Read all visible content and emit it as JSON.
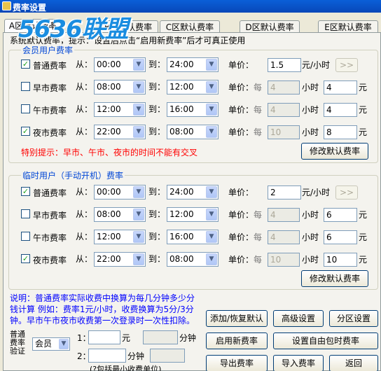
{
  "window": {
    "title": "费率设置"
  },
  "tabs": [
    {
      "label": "A区默认费率"
    },
    {
      "label": "B区默认费率"
    },
    {
      "label": "C区默认费率"
    },
    {
      "label": "D区默认费率"
    },
    {
      "label": "E区默认费率"
    }
  ],
  "hint": "系统默认费率，提示：设置后点击“启用新费率”后才可真正使用",
  "watermark": "5636联盟",
  "common": {
    "from": "从：",
    "to": "到：",
    "price": "单价：",
    "per": "每",
    "hour": "小时",
    "yuan": "元",
    "yuan_per_hour": "元/小时",
    "next_btn": ">>"
  },
  "member": {
    "title": "会员用户费率",
    "rows": [
      {
        "name": "普通费率",
        "checked": true,
        "from": "00:00",
        "to": "24:00",
        "price": "1.5",
        "per_hours": "",
        "amount": ""
      },
      {
        "name": "早市费率",
        "checked": false,
        "from": "08:00",
        "to": "12:00",
        "price": "",
        "per_hours": "4",
        "amount": "4"
      },
      {
        "name": "午市费率",
        "checked": false,
        "from": "12:00",
        "to": "16:00",
        "price": "",
        "per_hours": "4",
        "amount": "4"
      },
      {
        "name": "夜市费率",
        "checked": true,
        "from": "22:00",
        "to": "08:00",
        "price": "",
        "per_hours": "10",
        "amount": "8"
      }
    ],
    "warning": "特别提示：早市、午市、夜市的时间不能有交叉",
    "modify_btn": "修改默认费率"
  },
  "temp": {
    "title": "临时用户（手动开机）费率",
    "rows": [
      {
        "name": "普通费率",
        "checked": true,
        "from": "00:00",
        "to": "24:00",
        "price": "2",
        "per_hours": "",
        "amount": ""
      },
      {
        "name": "早市费率",
        "checked": false,
        "from": "08:00",
        "to": "12:00",
        "price": "",
        "per_hours": "4",
        "amount": "6"
      },
      {
        "name": "午市费率",
        "checked": false,
        "from": "12:00",
        "to": "16:00",
        "price": "",
        "per_hours": "4",
        "amount": "6"
      },
      {
        "name": "夜市费率",
        "checked": true,
        "from": "22:00",
        "to": "08:00",
        "price": "",
        "per_hours": "10",
        "amount": "10"
      }
    ],
    "modify_btn": "修改默认费率"
  },
  "note": "说明：普通费率实际收费中换算为每几分钟多少分钱计算 例如：费率1元/小时，收费换算为5分/3分钟。早市午市夜市收费第一次登录时一次性扣除。",
  "verify": {
    "label": "普通费率验证",
    "select": "会员",
    "row1_prefix": "1：",
    "row1_unit1": "元",
    "row1_unit2": "分钟",
    "row2_prefix": "2：",
    "row2_unit1": "分钟",
    "footer": "(?包括最小收费单位)"
  },
  "buttons": {
    "restore": "添加/恢复默认",
    "advanced": "高级设置",
    "zone": "分区设置",
    "enable": "启用新费率",
    "free_pkg": "设置自由包时费率",
    "export": "导出费率",
    "import": "导入费率",
    "back": "返回"
  }
}
